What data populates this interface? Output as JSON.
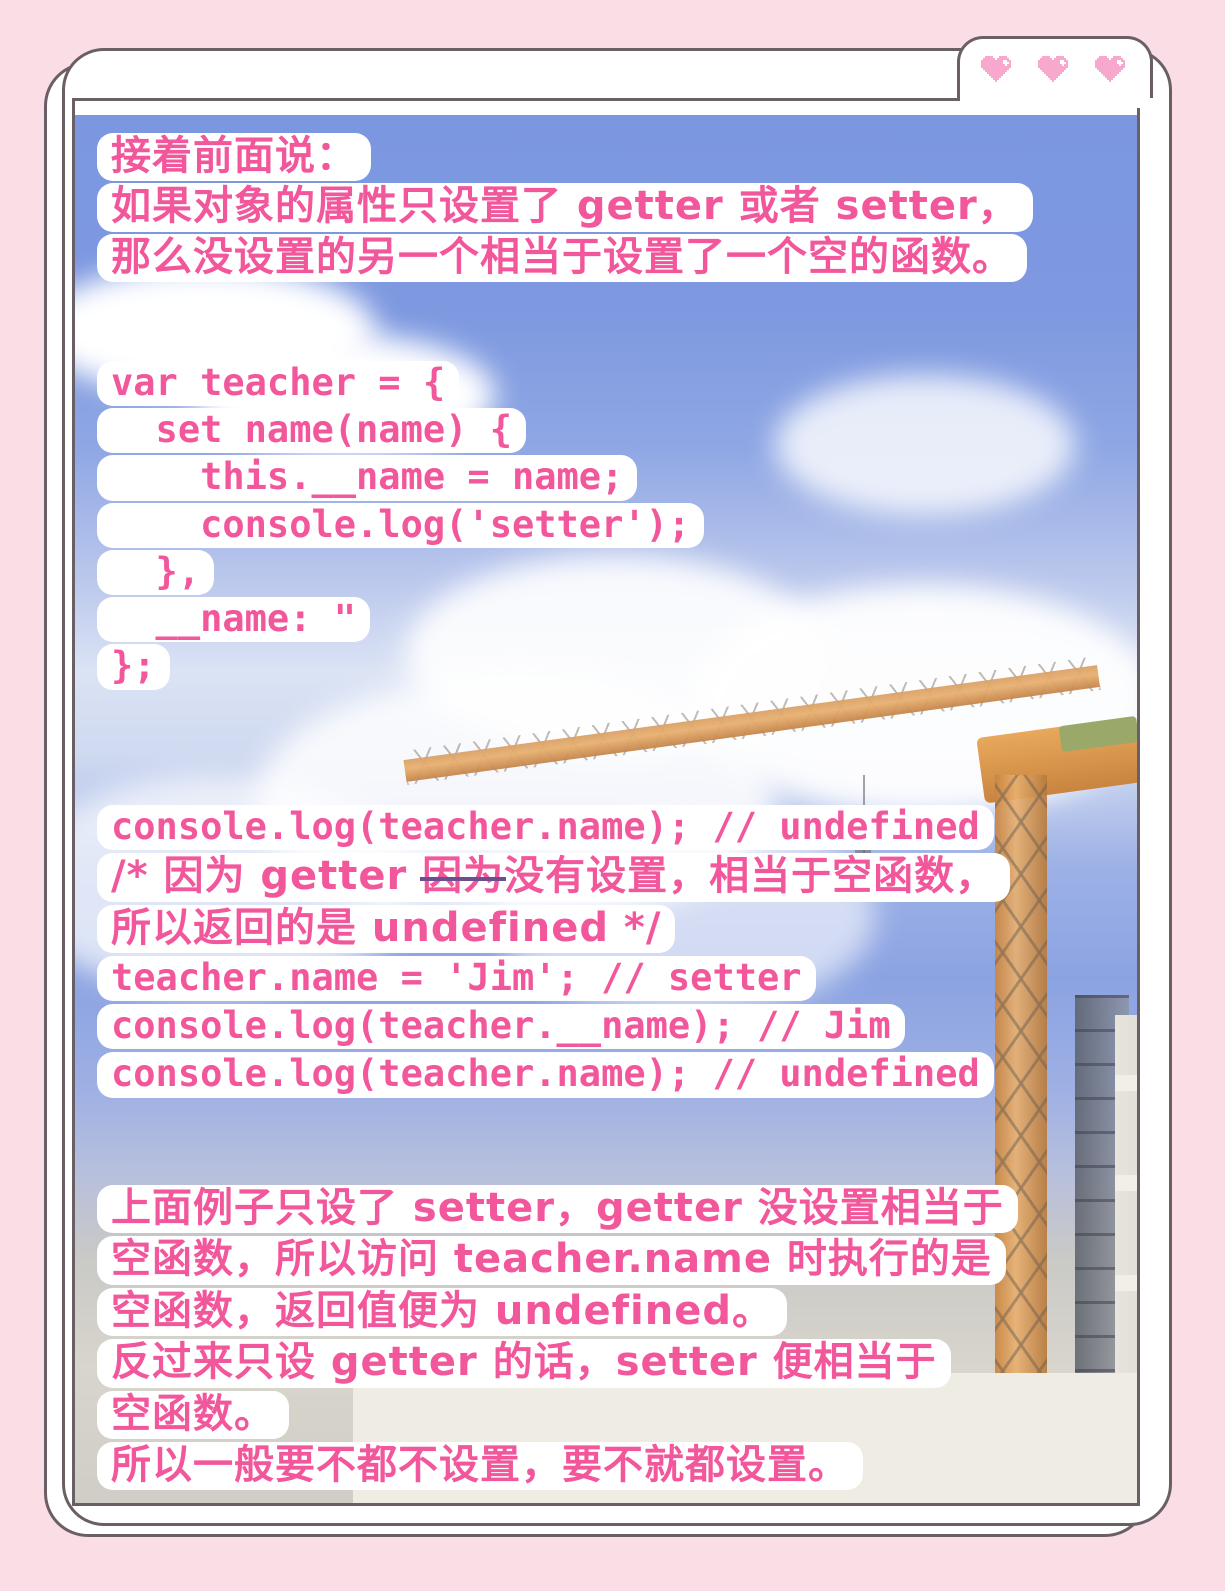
{
  "theme": {
    "page_background": "#fbdde6",
    "card_background": "#ffffff",
    "card_border": "#6b5f66",
    "text_pink": "#f2569b",
    "heart_pink": "#f9a8cd",
    "sky_blue": "#7b97e0",
    "strike_purple": "#6b4f8f"
  },
  "decor": {
    "hearts": [
      {
        "name": "heart-icon-1"
      },
      {
        "name": "heart-icon-2"
      },
      {
        "name": "heart-icon-3"
      }
    ]
  },
  "photo": {
    "subject": "construction site with orange tower crane against blue sky and clouds"
  },
  "content": {
    "intro": {
      "lines": [
        "接着前面说：",
        "如果对象的属性只设置了 getter 或者 setter，",
        "那么没设置的另一个相当于设置了一个空的函数。"
      ]
    },
    "code": {
      "lines": [
        "var teacher = {",
        "  set name(name) {",
        "    this.__name = name;",
        "    console.log('setter');",
        "  },",
        "  __name: \"",
        "};"
      ]
    },
    "console": {
      "lines": [
        "console.log(teacher.name); // undefined",
        "",
        "所以返回的是 undefined */",
        "teacher.name = 'Jim'; // setter",
        "console.log(teacher.__name); // Jim",
        "console.log(teacher.name); // undefined"
      ],
      "comment_line": {
        "before": "/* 因为 getter ",
        "struck": "因为",
        "after": "没有设置，相当于空函数，"
      }
    },
    "summary": {
      "lines": [
        "上面例子只设了 setter，getter 没设置相当于",
        "空函数，所以访问 teacher.name 时执行的是",
        "空函数，返回值便为 undefined。",
        "反过来只设 getter 的话，setter 便相当于",
        "空函数。",
        "所以一般要不都不设置，要不就都设置。"
      ]
    }
  }
}
